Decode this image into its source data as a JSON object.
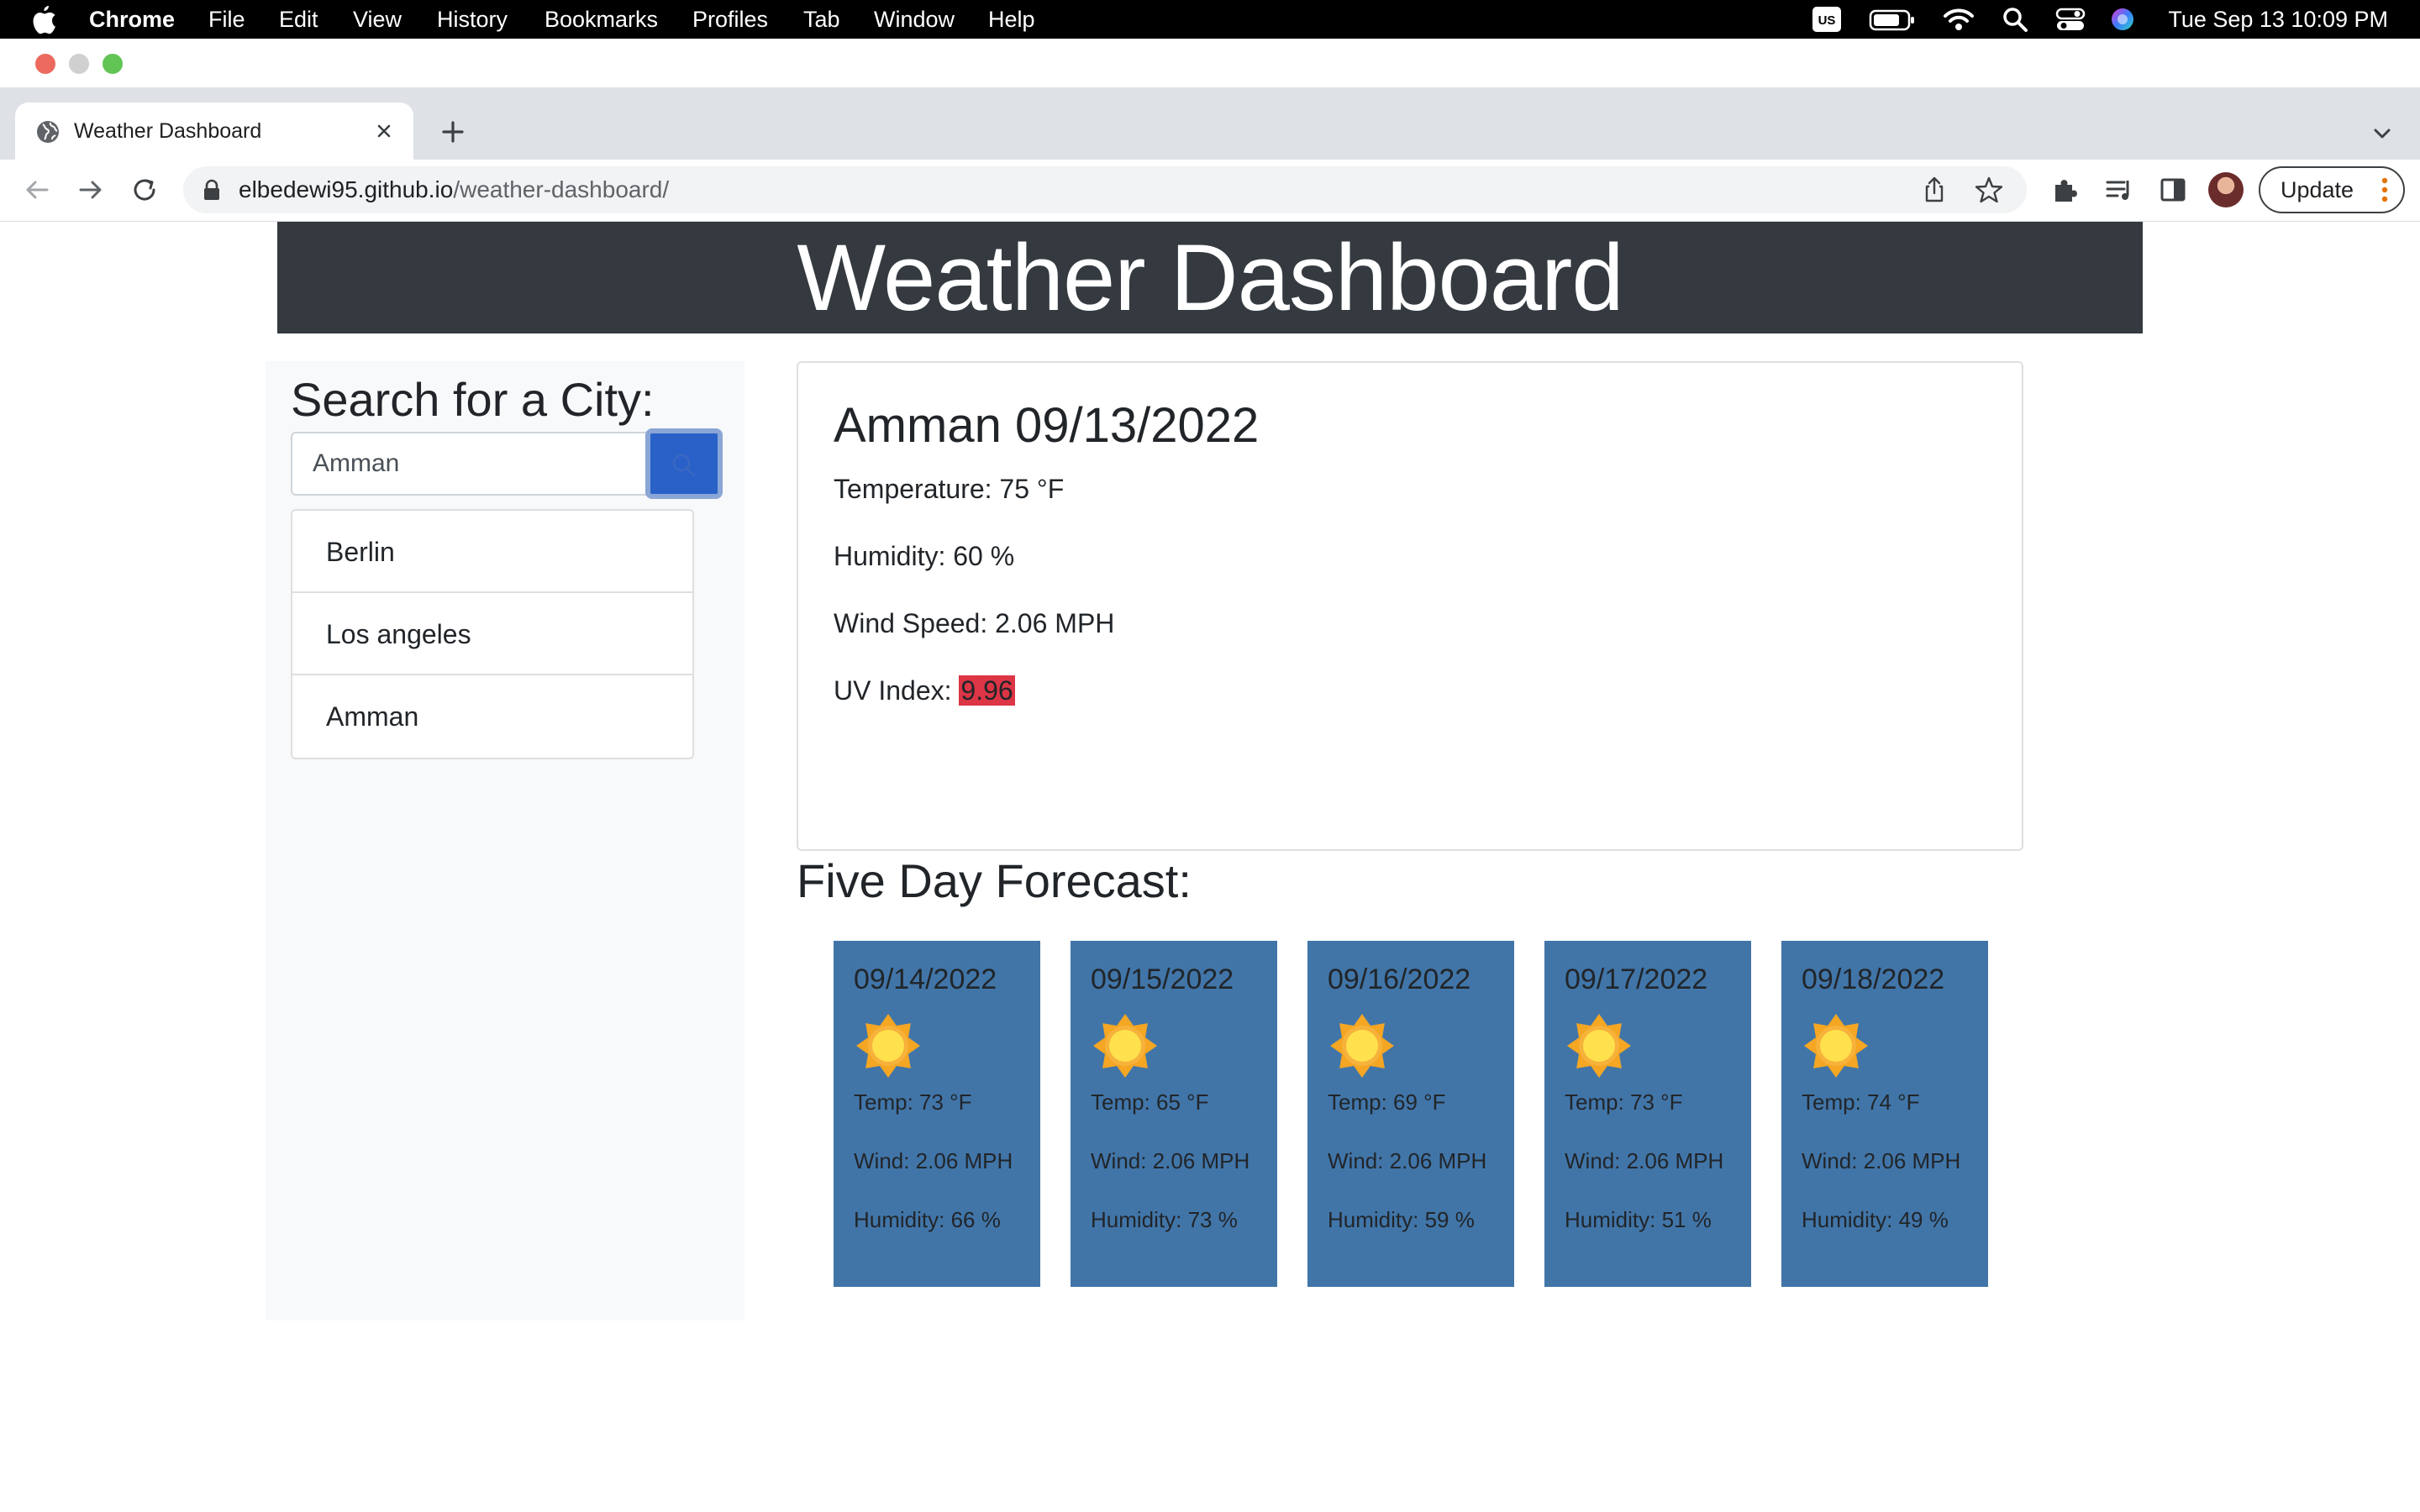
{
  "os_menu": {
    "app": "Chrome",
    "items": [
      "File",
      "Edit",
      "View",
      "History",
      "Bookmarks",
      "Profiles",
      "Tab",
      "Window",
      "Help"
    ],
    "input_source": "US",
    "clock": "Tue Sep 13  10:09 PM"
  },
  "browser": {
    "tab_title": "Weather Dashboard",
    "url_host": "elbedewi95.github.io",
    "url_path": "/weather-dashboard/",
    "update_label": "Update"
  },
  "page": {
    "header_title": "Weather Dashboard",
    "search": {
      "heading": "Search for a City:",
      "value": "Amman"
    },
    "history": [
      "Berlin",
      "Los angeles",
      "Amman"
    ],
    "current": {
      "title": "Amman 09/13/2022",
      "temperature": "Temperature: 75 °F",
      "humidity": "Humidity: 60 %",
      "wind": "Wind Speed: 2.06 MPH",
      "uv_label": "UV Index: ",
      "uv_value": "9.96",
      "uv_color": "#dc3545"
    },
    "forecast_title": "Five Day Forecast:",
    "forecast": [
      {
        "date": "09/14/2022",
        "icon": "sun-icon",
        "temp": "Temp: 73 °F",
        "wind": "Wind: 2.06 MPH",
        "humidity": "Humidity: 66 %"
      },
      {
        "date": "09/15/2022",
        "icon": "sun-icon",
        "temp": "Temp: 65 °F",
        "wind": "Wind: 2.06 MPH",
        "humidity": "Humidity: 73 %"
      },
      {
        "date": "09/16/2022",
        "icon": "sun-icon",
        "temp": "Temp: 69 °F",
        "wind": "Wind: 2.06 MPH",
        "humidity": "Humidity: 59 %"
      },
      {
        "date": "09/17/2022",
        "icon": "sun-icon",
        "temp": "Temp: 73 °F",
        "wind": "Wind: 2.06 MPH",
        "humidity": "Humidity: 51 %"
      },
      {
        "date": "09/18/2022",
        "icon": "sun-icon",
        "temp": "Temp: 74 °F",
        "wind": "Wind: 2.06 MPH",
        "humidity": "Humidity: 49 %"
      }
    ]
  },
  "colors": {
    "header_bg": "#343a40",
    "card_bg": "#4175a8",
    "search_button": "#2961c9"
  }
}
